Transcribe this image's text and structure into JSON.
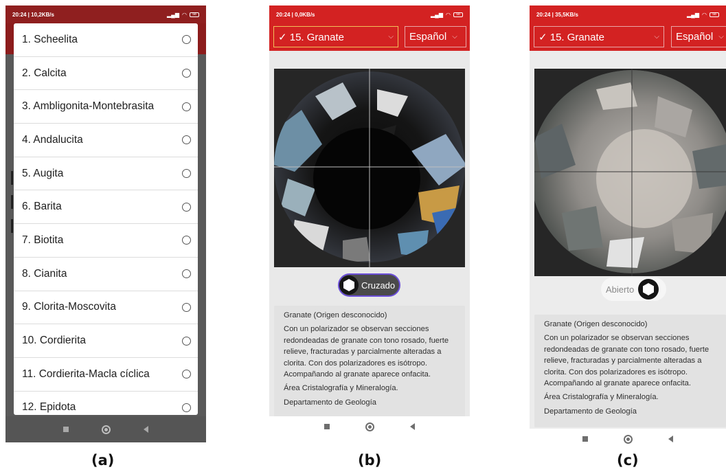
{
  "panel_a": {
    "status": {
      "left": "20:24 | 10,2KB/s",
      "battery": "58"
    },
    "options": [
      "1. Scheelita",
      "2. Calcita",
      "3. Ambligonita-Montebrasita",
      "4. Andalucita",
      "5. Augita",
      "6. Barita",
      "7. Biotita",
      "8. Cianita",
      "9. Clorita-Moscovita",
      "10. Cordierita",
      "11. Cordierita-Macla cíclica",
      "12. Epidota"
    ],
    "caption": "(a)"
  },
  "panel_b": {
    "status": {
      "left": "20:24 | 0,0KB/s",
      "battery": "58"
    },
    "mineral_select": "✓ 15. Granate",
    "language_select": "Español",
    "toggle_label": "Cruzado",
    "desc": {
      "title": "Granate (Origen desconocido)",
      "body": "Con un polarizador se observan secciones redondeadas de granate con tono rosado, fuerte relieve, fracturadas y parcialmente alteradas a clorita. Con dos polarizadores es isótropo. Acompañando al granate aparece onfacita.",
      "area": "Área Cristalografía y Mineralogía.",
      "dept": "Departamento de Geología"
    },
    "caption": "(b)"
  },
  "panel_c": {
    "status": {
      "left": "20:24 | 35,5KB/s",
      "battery": "58"
    },
    "mineral_select": "✓ 15. Granate",
    "language_select": "Español",
    "toggle_label": "Abierto",
    "desc": {
      "title": "Granate (Origen desconocido)",
      "body": "Con un polarizador se observan secciones redondeadas de granate con tono rosado, fuerte relieve, fracturadas y parcialmente alteradas a clorita. Con dos polarizadores es isótropo. Acompañando al granate aparece onfacita.",
      "area": "Área Cristalografía y Mineralogía.",
      "dept": "Departamento de Geología"
    },
    "caption": "(c)"
  },
  "colors": {
    "header_red": "#d32222",
    "dialog_bg": "#ffffff",
    "dim_overlay": "#595959"
  }
}
